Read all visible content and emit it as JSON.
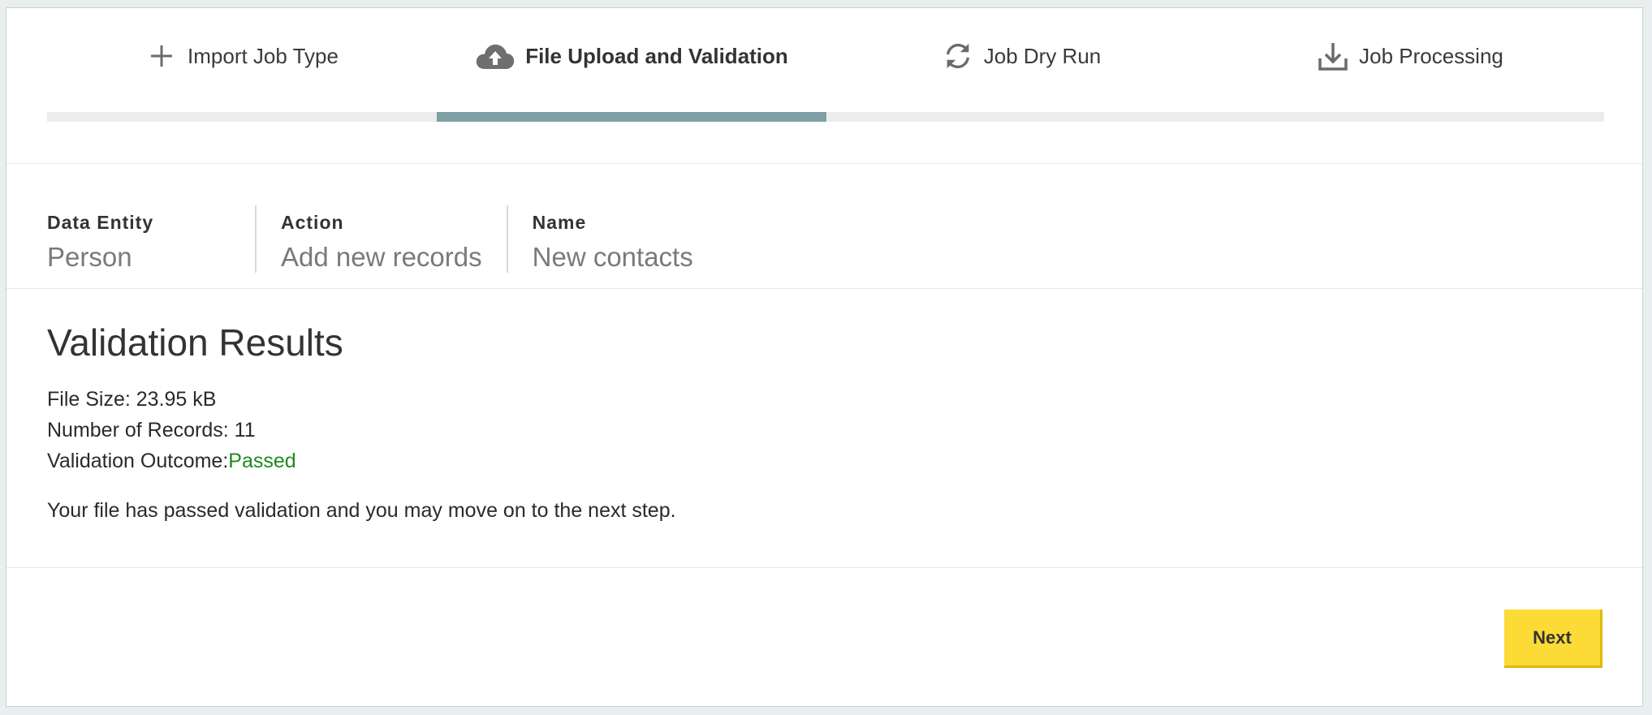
{
  "steps": [
    {
      "label": "Import Job Type",
      "icon": "plus-icon",
      "active": false
    },
    {
      "label": "File Upload and Validation",
      "icon": "cloud-upload-icon",
      "active": true
    },
    {
      "label": "Job Dry Run",
      "icon": "refresh-icon",
      "active": false
    },
    {
      "label": "Job Processing",
      "icon": "download-icon",
      "active": false
    }
  ],
  "summary": {
    "data_entity": {
      "label": "Data Entity",
      "value": "Person"
    },
    "action": {
      "label": "Action",
      "value": "Add new records"
    },
    "name": {
      "label": "Name",
      "value": "New contacts"
    }
  },
  "validation": {
    "title": "Validation Results",
    "file_size_label": "File Size: ",
    "file_size_value": "23.95 kB",
    "records_label": "Number of Records: ",
    "records_value": "11",
    "outcome_label": "Validation Outcome:",
    "outcome_value": "Passed",
    "message": "Your file has passed validation and you may move on to the next step."
  },
  "footer": {
    "next_label": "Next"
  },
  "colors": {
    "active_step_bar": "#7f9fa3",
    "track": "#ececec",
    "passed": "#1e8a1e",
    "next_button": "#fddb36"
  }
}
